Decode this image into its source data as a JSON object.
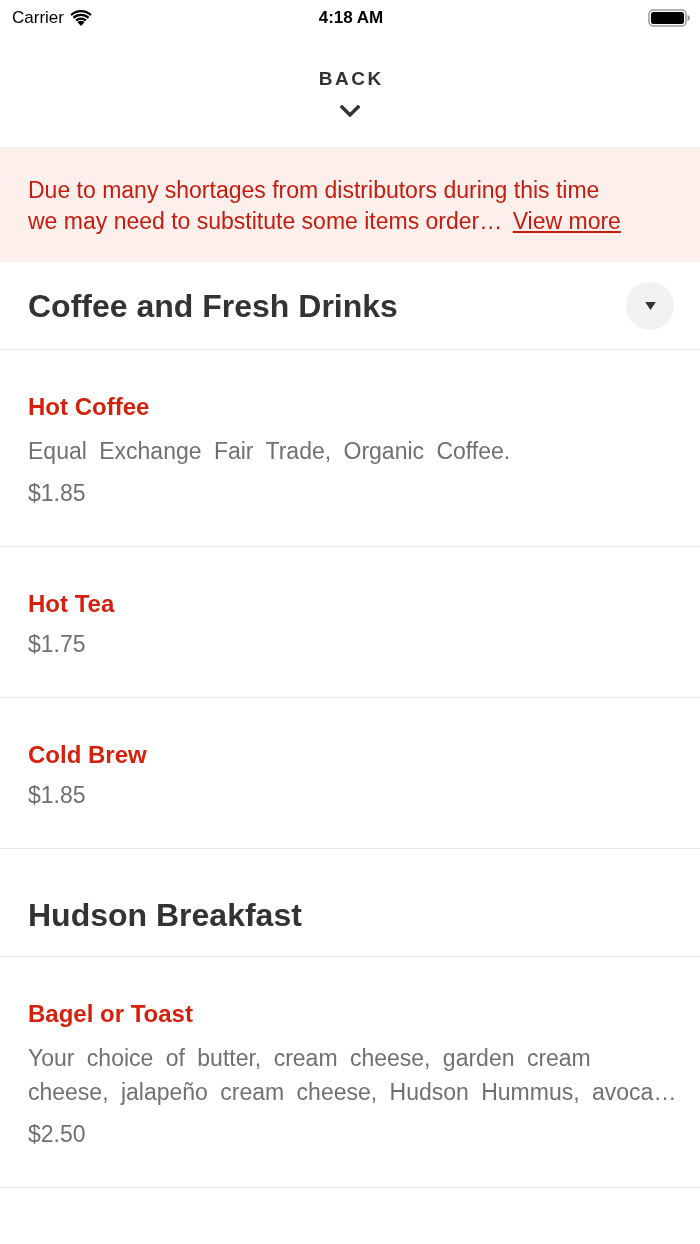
{
  "status_bar": {
    "carrier": "Carrier",
    "time": "4:18 AM"
  },
  "nav": {
    "back_label": "BACK"
  },
  "notice": {
    "text": "Due to many shortages from distributors during this time we may need to substitute some items order…",
    "link": "View more"
  },
  "sections": [
    {
      "title": "Coffee and Fresh Drinks",
      "collapse_button": true,
      "items": [
        {
          "name": "Hot Coffee",
          "description": "Equal Exchange Fair Trade, Organic Coffee.",
          "price": "$1.85"
        },
        {
          "name": "Hot Tea",
          "price": "$1.75"
        },
        {
          "name": "Cold Brew",
          "price": "$1.85"
        }
      ]
    },
    {
      "title": "Hudson Breakfast",
      "collapse_button": false,
      "items": [
        {
          "name": "Bagel or Toast",
          "description": "Your choice of butter, cream cheese, garden cream cheese, jalapeño cream cheese, Hudson Hummus, avoca…",
          "price": "$2.50"
        }
      ]
    }
  ]
}
